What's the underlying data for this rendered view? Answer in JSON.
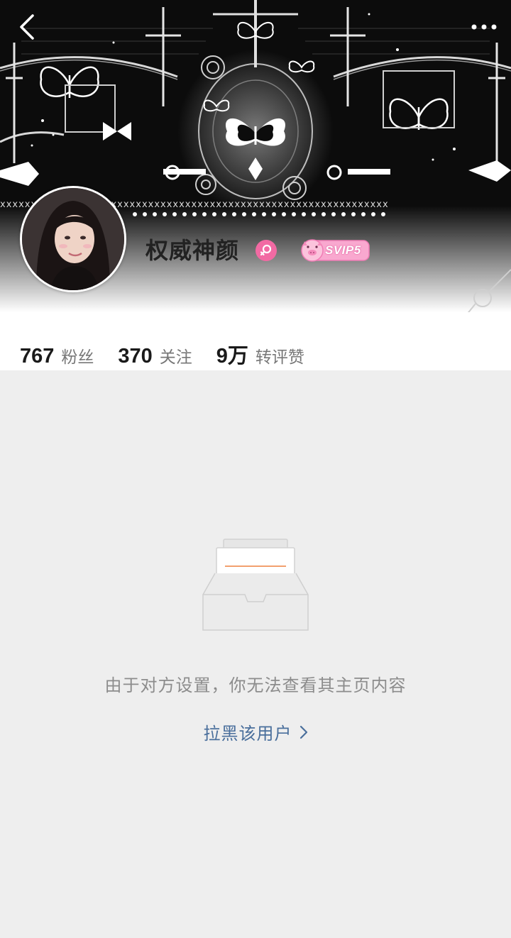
{
  "nav": {
    "back_icon": "chevron-left-icon",
    "more_icon": "more-dots-icon"
  },
  "profile": {
    "username": "权威神颜",
    "gender_icon": "female-icon",
    "gender_color": "#f26aa3",
    "vip_badge": "SVIP5",
    "vip_color": "#f9a8cf"
  },
  "stats": [
    {
      "value": "767",
      "label": "粉丝"
    },
    {
      "value": "370",
      "label": "关注"
    },
    {
      "value": "9万",
      "label": "转评赞"
    }
  ],
  "content": {
    "empty_icon": "empty-inbox-icon",
    "notice": "由于对方设置，你无法查看其主页内容",
    "block_link": "拉黑该用户",
    "block_icon": "chevron-right-icon",
    "link_color": "#4a6f9c"
  }
}
